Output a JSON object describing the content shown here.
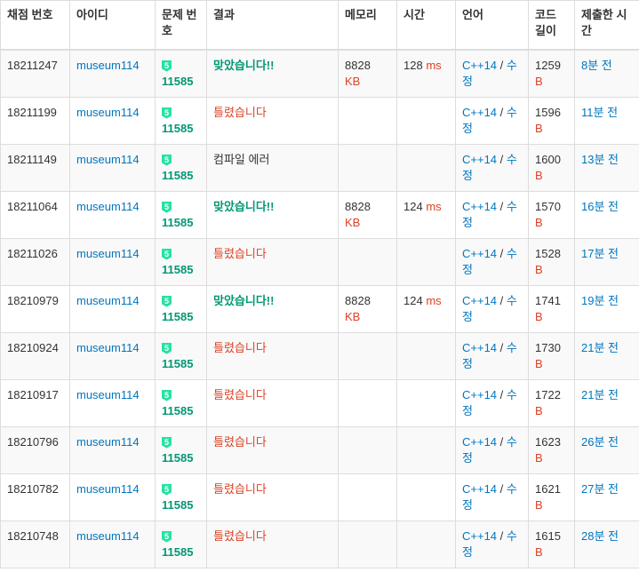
{
  "headers": {
    "id": "채점 번호",
    "user": "아이디",
    "problem": "문제 번호",
    "result": "결과",
    "memory": "메모리",
    "time": "시간",
    "language": "언어",
    "code_length": "코드 길이",
    "submitted": "제출한 시간"
  },
  "tier_badge": "5",
  "colors": {
    "accepted": "#009874",
    "wrong": "#dd4124",
    "link": "#0076c0",
    "tier": "#27e2a4"
  },
  "rows": [
    {
      "id": "18211247",
      "user": "museum114",
      "problem": "11585",
      "result": "맞았습니다!!",
      "result_type": "ac",
      "memory": "8828",
      "memory_unit": "KB",
      "time": "128",
      "time_unit": "ms",
      "lang": "C++14",
      "edit_sep": "/",
      "edit": "수정",
      "length": "1259",
      "length_unit": "B",
      "ago": "8분 전"
    },
    {
      "id": "18211199",
      "user": "museum114",
      "problem": "11585",
      "result": "틀렸습니다",
      "result_type": "wa",
      "memory": "",
      "memory_unit": "",
      "time": "",
      "time_unit": "",
      "lang": "C++14",
      "edit_sep": "/",
      "edit": "수정",
      "length": "1596",
      "length_unit": "B",
      "ago": "11분 전"
    },
    {
      "id": "18211149",
      "user": "museum114",
      "problem": "11585",
      "result": "컴파일 에러",
      "result_type": "ce",
      "memory": "",
      "memory_unit": "",
      "time": "",
      "time_unit": "",
      "lang": "C++14",
      "edit_sep": "/",
      "edit": "수정",
      "length": "1600",
      "length_unit": "B",
      "ago": "13분 전"
    },
    {
      "id": "18211064",
      "user": "museum114",
      "problem": "11585",
      "result": "맞았습니다!!",
      "result_type": "ac",
      "memory": "8828",
      "memory_unit": "KB",
      "time": "124",
      "time_unit": "ms",
      "lang": "C++14",
      "edit_sep": "/",
      "edit": "수정",
      "length": "1570",
      "length_unit": "B",
      "ago": "16분 전"
    },
    {
      "id": "18211026",
      "user": "museum114",
      "problem": "11585",
      "result": "틀렸습니다",
      "result_type": "wa",
      "memory": "",
      "memory_unit": "",
      "time": "",
      "time_unit": "",
      "lang": "C++14",
      "edit_sep": "/",
      "edit": "수정",
      "length": "1528",
      "length_unit": "B",
      "ago": "17분 전"
    },
    {
      "id": "18210979",
      "user": "museum114",
      "problem": "11585",
      "result": "맞았습니다!!",
      "result_type": "ac",
      "memory": "8828",
      "memory_unit": "KB",
      "time": "124",
      "time_unit": "ms",
      "lang": "C++14",
      "edit_sep": "/",
      "edit": "수정",
      "length": "1741",
      "length_unit": "B",
      "ago": "19분 전"
    },
    {
      "id": "18210924",
      "user": "museum114",
      "problem": "11585",
      "result": "틀렸습니다",
      "result_type": "wa",
      "memory": "",
      "memory_unit": "",
      "time": "",
      "time_unit": "",
      "lang": "C++14",
      "edit_sep": "/",
      "edit": "수정",
      "length": "1730",
      "length_unit": "B",
      "ago": "21분 전"
    },
    {
      "id": "18210917",
      "user": "museum114",
      "problem": "11585",
      "result": "틀렸습니다",
      "result_type": "wa",
      "memory": "",
      "memory_unit": "",
      "time": "",
      "time_unit": "",
      "lang": "C++14",
      "edit_sep": "/",
      "edit": "수정",
      "length": "1722",
      "length_unit": "B",
      "ago": "21분 전"
    },
    {
      "id": "18210796",
      "user": "museum114",
      "problem": "11585",
      "result": "틀렸습니다",
      "result_type": "wa",
      "memory": "",
      "memory_unit": "",
      "time": "",
      "time_unit": "",
      "lang": "C++14",
      "edit_sep": "/",
      "edit": "수정",
      "length": "1623",
      "length_unit": "B",
      "ago": "26분 전"
    },
    {
      "id": "18210782",
      "user": "museum114",
      "problem": "11585",
      "result": "틀렸습니다",
      "result_type": "wa",
      "memory": "",
      "memory_unit": "",
      "time": "",
      "time_unit": "",
      "lang": "C++14",
      "edit_sep": "/",
      "edit": "수정",
      "length": "1621",
      "length_unit": "B",
      "ago": "27분 전"
    },
    {
      "id": "18210748",
      "user": "museum114",
      "problem": "11585",
      "result": "틀렸습니다",
      "result_type": "wa",
      "memory": "",
      "memory_unit": "",
      "time": "",
      "time_unit": "",
      "lang": "C++14",
      "edit_sep": "/",
      "edit": "수정",
      "length": "1615",
      "length_unit": "B",
      "ago": "28분 전"
    }
  ]
}
